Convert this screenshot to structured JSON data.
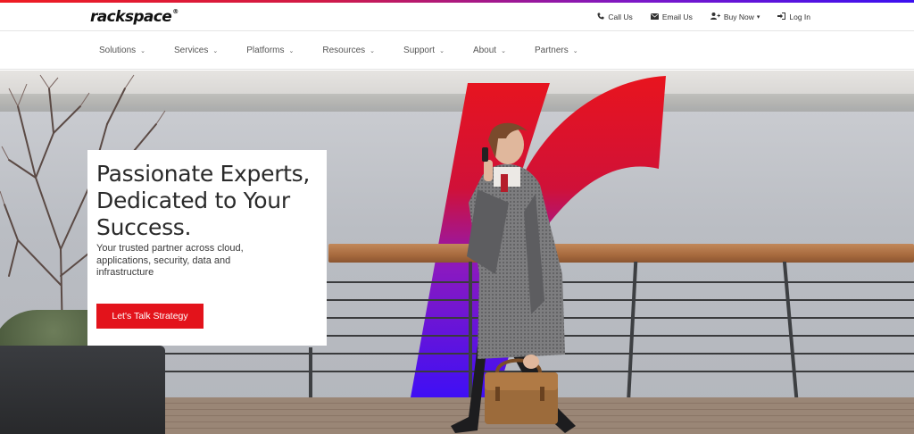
{
  "brand": {
    "logo_text": "rackspace",
    "logo_mark": "®",
    "accent_colors": [
      "#ef1b22",
      "#7b17c9",
      "#3b10f0"
    ]
  },
  "utility_nav": [
    {
      "label": "Call Us",
      "icon": "phone-icon"
    },
    {
      "label": "Email Us",
      "icon": "envelope-icon"
    },
    {
      "label": "Buy Now",
      "icon": "user-plus-icon",
      "caret": "▾"
    },
    {
      "label": "Log In",
      "icon": "sign-in-icon"
    }
  ],
  "main_nav": [
    {
      "label": "Solutions"
    },
    {
      "label": "Services"
    },
    {
      "label": "Platforms"
    },
    {
      "label": "Resources"
    },
    {
      "label": "Support"
    },
    {
      "label": "About"
    },
    {
      "label": "Partners"
    }
  ],
  "main_nav_chevron": "⌄",
  "hero": {
    "title": "Passionate Experts, Dedicated to Your Success.",
    "subtitle": "Your trusted partner across cloud, applications, security, data and infrastructure",
    "cta_label": "Let's Talk Strategy",
    "cta_color": "#e3131b"
  }
}
